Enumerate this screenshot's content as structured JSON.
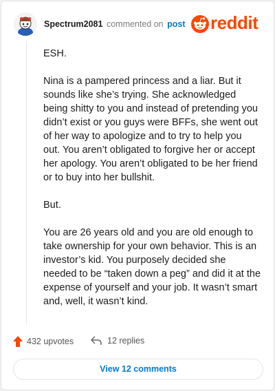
{
  "header": {
    "username": "Spectrum2081",
    "commented_on": "commented on",
    "post_link": "post",
    "brand": "reddit",
    "brand_color": "#ff4500"
  },
  "comment": {
    "paragraphs": [
      "ESH.",
      "Nina is a pampered princess and a liar. But it sounds like she’s trying. She acknowledged being shitty to you and instead of pretending you didn’t exist or you guys were BFFs, she went out of her way to apologize and to try to help you out. You aren’t obligated to forgive her or accept her apology. You aren’t obligated to be her friend or to buy into her bullshit.",
      "But.",
      "You are 26 years old and you are old enough to take ownership for your own behavior. This is an investor’s kid. You purposely decided she needed to be “taken down a peg” and did it at the expense of yourself and your job. It wasn’t smart and, well, it wasn’t kind."
    ]
  },
  "actions": {
    "upvotes": "432 upvotes",
    "replies": "12 replies",
    "view_comments": "View 12 comments"
  },
  "icons": {
    "avatar": "avatar",
    "brand": "reddit-snoo-icon",
    "upvote": "upvote-arrow-icon",
    "reply": "reply-arrow-icon"
  },
  "colors": {
    "link": "#0079d3",
    "upvote": "#ff4500"
  }
}
